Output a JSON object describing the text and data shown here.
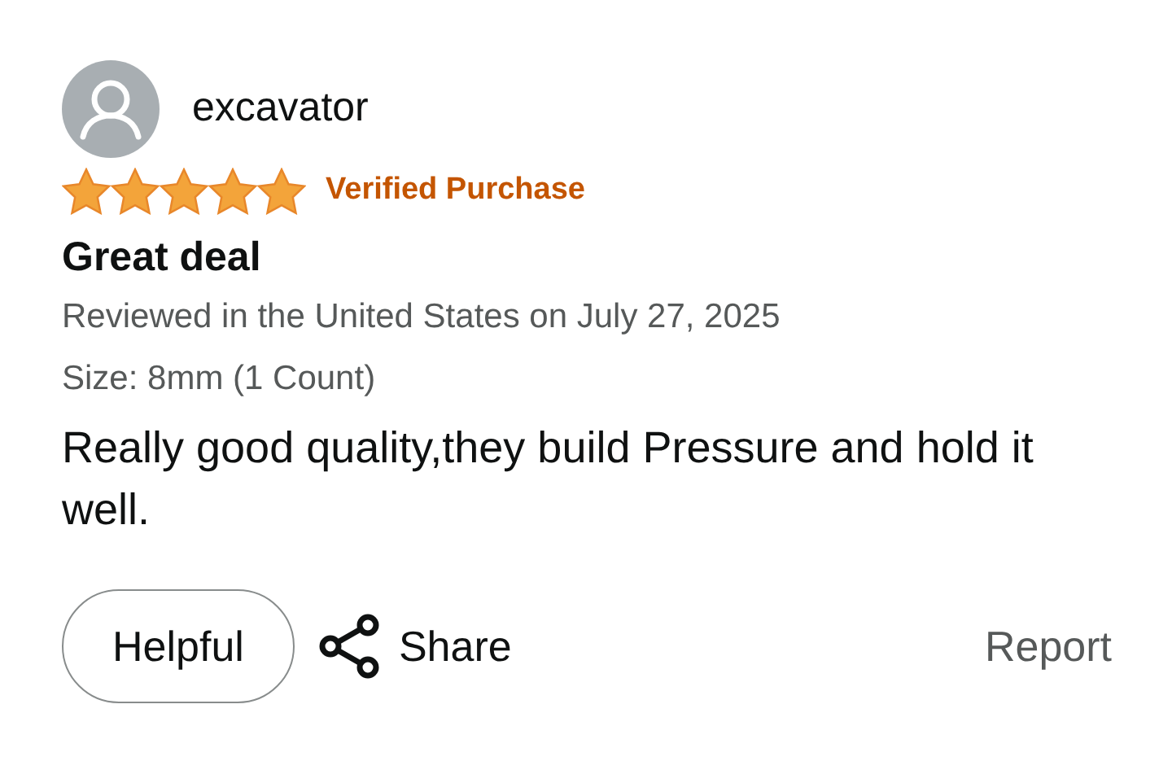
{
  "review": {
    "reviewer": "excavator",
    "stars": 5,
    "badge": "Verified Purchase",
    "title": "Great deal",
    "reviewed": "Reviewed in the United States on July 27, 2025",
    "variant": "Size: 8mm (1 Count)",
    "body": "Really good quality,they build Pressure and hold it well."
  },
  "actions": {
    "helpful": "Helpful",
    "share": "Share",
    "report": "Report"
  }
}
